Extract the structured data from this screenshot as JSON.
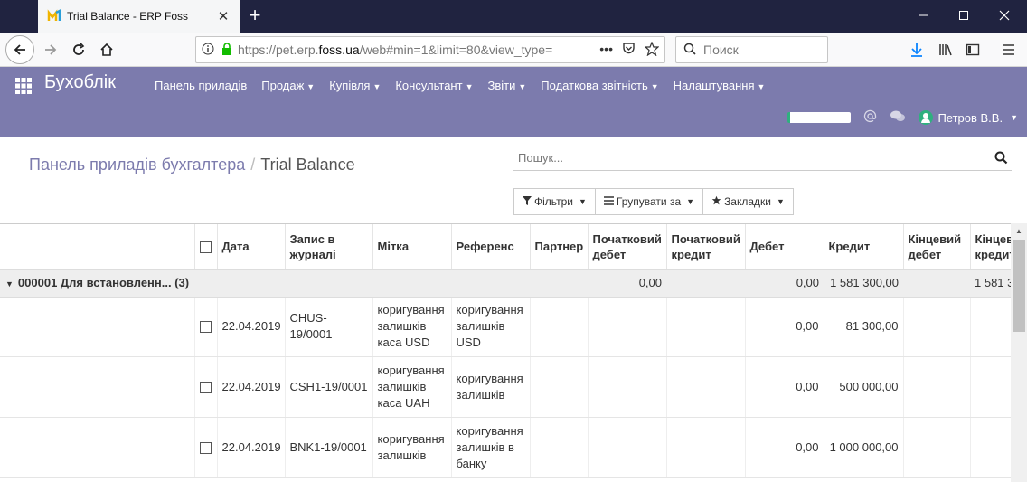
{
  "browser": {
    "tab_title": "Trial Balance - ERP Foss",
    "tab_close": "✕",
    "new_tab": "+",
    "url_prefix": "https://pet.erp.",
    "url_domain": "foss.ua",
    "url_rest": "/web#min=1&limit=80&view_type=",
    "url_more": "•••",
    "search_placeholder": "Поиск"
  },
  "app": {
    "brand": "Бухоблік",
    "menu": [
      {
        "label": "Панель приладів",
        "dropdown": false
      },
      {
        "label": "Продаж",
        "dropdown": true
      },
      {
        "label": "Купівля",
        "dropdown": true
      },
      {
        "label": "Консультант",
        "dropdown": true
      },
      {
        "label": "Звіти",
        "dropdown": true
      },
      {
        "label": "Податкова звітність",
        "dropdown": true
      },
      {
        "label": "Налаштування",
        "dropdown": true
      }
    ],
    "user_name": "Петров В.В."
  },
  "breadcrumb": {
    "parent": "Панель приладів бухгалтера",
    "separator": "/",
    "current": "Trial Balance"
  },
  "search": {
    "placeholder": "Пошук..."
  },
  "buttons": {
    "filters": "Фільтри",
    "group_by": "Групувати за",
    "favorites": "Закладки"
  },
  "table": {
    "columns": [
      "",
      "",
      "Дата",
      "Запис в журналі",
      "Мітка",
      "Референс",
      "Партнер",
      "Початковий дебет",
      "Початковий кредит",
      "Дебет",
      "Кредит",
      "Кінцевий дебет",
      "Кінцевий кредит"
    ],
    "group": {
      "label": "000001 Для встановленн... (3)",
      "initial_debit": "0,00",
      "debit": "0,00",
      "credit": "1 581 300,00",
      "final_credit": "1 581 3"
    },
    "rows": [
      {
        "date": "22.04.2019",
        "entry": "CHUS-19/0001",
        "label": "коригування залишків каса USD",
        "ref": "коригування залишків USD",
        "debit": "0,00",
        "credit": "81 300,00"
      },
      {
        "date": "22.04.2019",
        "entry": "CSH1-19/0001",
        "label": "коригування залишків каса UAH",
        "ref": "коригування залишків",
        "debit": "0,00",
        "credit": "500 000,00"
      },
      {
        "date": "22.04.2019",
        "entry": "BNK1-19/0001",
        "label": "коригування залишків",
        "ref": "коригування залишків в банку",
        "debit": "0,00",
        "credit": "1 000 000,00"
      }
    ]
  }
}
